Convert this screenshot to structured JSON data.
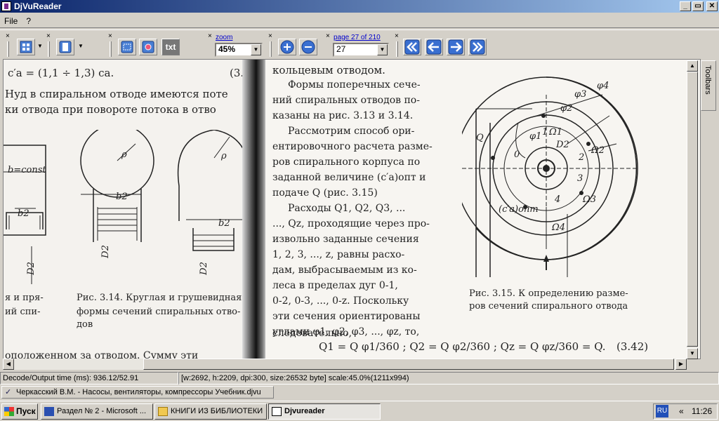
{
  "window": {
    "title": "DjVuReader",
    "min": "_",
    "max": "▭",
    "close": "✕"
  },
  "menu": [
    "File",
    "?"
  ],
  "toolbar": {
    "zoom_label": "zoom",
    "zoom_value": "45%",
    "page_label": "page 27 of 210",
    "page_value": "27",
    "text_button": "txt",
    "icons": [
      "layout-icon",
      "page-icon",
      "select-icon",
      "image-icon",
      "text-icon",
      "zoom-in-icon",
      "zoom-out-icon",
      "first-page-icon",
      "prev-page-icon",
      "next-page-icon",
      "last-page-icon"
    ]
  },
  "document": {
    "left": {
      "formula": "c′a = (1,1 ÷ 1,3) ca.",
      "eq_num": "(3.",
      "line1": "Hуд в спиральном отводе имеются поте",
      "line2": "ки отвода при повороте потока в отво",
      "b_const": "b=const",
      "b2a": "b2",
      "d2a": "D2",
      "b2b": "b2",
      "d2b": "D2",
      "b2c": "b2",
      "d2c": "D2",
      "rho1": "ρ",
      "rho2": "ρ",
      "cap_left1": "я и пря-",
      "cap_left2": "ий спи-",
      "caption1": "Рис. 3.14. Круглая и грушевидная",
      "caption2": "формы сечений спиральных отво-",
      "caption3": "дов",
      "bottom": "оположенном за отводом. Сумму эти"
    },
    "right": {
      "top_line": "кольцевым отводом.",
      "para": [
        "Формы поперечных сече-",
        "ний спиральных отводов по-",
        "казаны на рис. 3.13 и 3.14.",
        "Рассмотрим способ ори-",
        "ентировочного расчета разме-",
        "ров спирального корпуса по",
        "заданной величине (c′a)опт и",
        "подаче Q (рис. 3.15)",
        "Расходы Q1, Q2, Q3, ...",
        "..., Qz, проходящие через про-",
        "извольно заданные сечения",
        "1, 2, 3, ..., z, равны расхо-",
        "дам, выбрасываемым из ко-",
        "леса в пределах дуг 0-1,",
        "0-2, 0-3, ..., 0-z. Поскольку",
        "эти сечения ориентированы",
        "углами φ1, φ2, φ3, ..., φz, то,",
        "следовательно,"
      ],
      "fig_labels": [
        "φ4",
        "φ3",
        "φ2",
        "φ1",
        "Ω1",
        "Ω2",
        "Ω3",
        "Ω4",
        "D2",
        "Q",
        "0",
        "1",
        "2",
        "3",
        "4",
        "(c′a)опт"
      ],
      "caption1": "Рис. 3.15. К определению разме-",
      "caption2": "ров сечений спирального отвода",
      "formula": "Q1 = Q φ1/360 ;   Q2 = Q φ2/360 ;   Qz = Q φz/360 = Q.",
      "eq_num": "(3.42)"
    }
  },
  "side_tab": "Toolbars",
  "status": {
    "decode": "Decode/Output time (ms): 936.12/52.91",
    "info": "[w:2692, h:2209, dpi:300, size:26532 byte] scale:45.0%(1211x994)"
  },
  "doc_tab": "Черкасский В.М. - Насосы, вентиляторы, компрессоры Учебник.djvu",
  "taskbar": {
    "start": "Пуск",
    "tasks": [
      "Раздел № 2 - Microsoft ...",
      "КНИГИ ИЗ БИБЛИОТЕКИ",
      "Djvureader"
    ],
    "lang": "RU",
    "arrows": "«",
    "time": "11:26"
  }
}
